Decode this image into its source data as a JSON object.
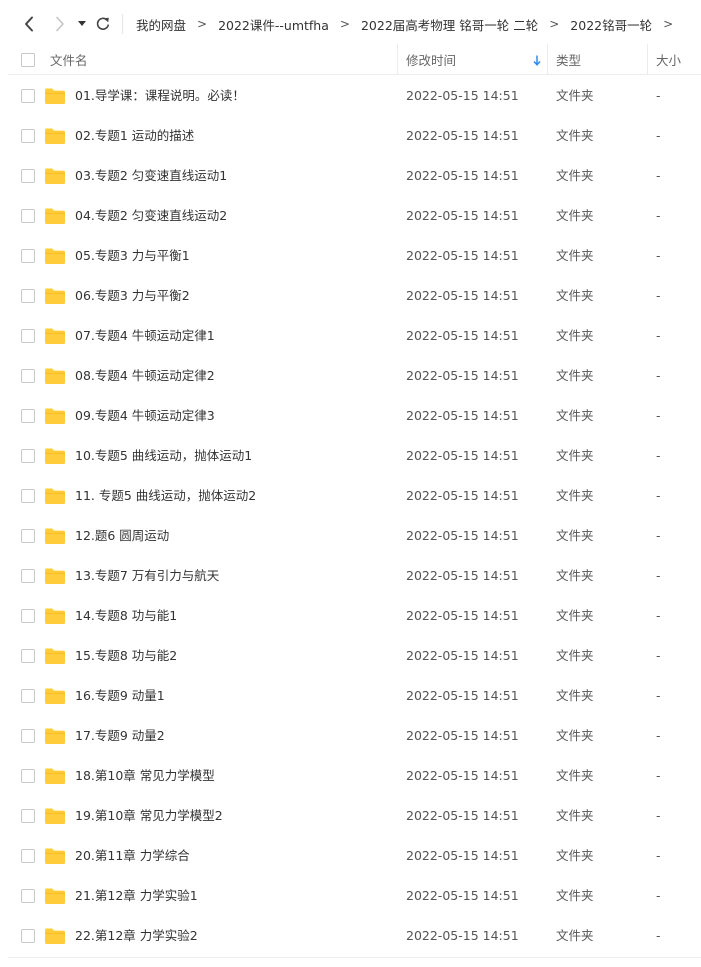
{
  "nav": {
    "back_icon": "chevron-left-icon",
    "forward_icon": "chevron-right-icon",
    "history_icon": "caret-down-icon",
    "refresh_icon": "refresh-icon"
  },
  "breadcrumb": [
    "我的网盘",
    "2022课件--umtfha",
    "2022届高考物理 铭哥一轮 二轮",
    "2022铭哥一轮"
  ],
  "breadcrumb_separator": ">",
  "columns": {
    "name": "文件名",
    "modified": "修改时间",
    "type": "类型",
    "size": "大小"
  },
  "sort": {
    "column": "modified",
    "direction": "down",
    "color": "#2b8cf0"
  },
  "folder_color": "#ffcd3c",
  "files": [
    {
      "name": "01.导学课：课程说明。必读！",
      "time": "2022-05-15 14:51",
      "type": "文件夹",
      "size": "-"
    },
    {
      "name": "02.专题1 运动的描述",
      "time": "2022-05-15 14:51",
      "type": "文件夹",
      "size": "-"
    },
    {
      "name": "03.专题2 匀变速直线运动1",
      "time": "2022-05-15 14:51",
      "type": "文件夹",
      "size": "-"
    },
    {
      "name": "04.专题2 匀变速直线运动2",
      "time": "2022-05-15 14:51",
      "type": "文件夹",
      "size": "-"
    },
    {
      "name": "05.专题3 力与平衡1",
      "time": "2022-05-15 14:51",
      "type": "文件夹",
      "size": "-"
    },
    {
      "name": "06.专题3 力与平衡2",
      "time": "2022-05-15 14:51",
      "type": "文件夹",
      "size": "-"
    },
    {
      "name": "07.专题4 牛顿运动定律1",
      "time": "2022-05-15 14:51",
      "type": "文件夹",
      "size": "-"
    },
    {
      "name": "08.专题4 牛顿运动定律2",
      "time": "2022-05-15 14:51",
      "type": "文件夹",
      "size": "-"
    },
    {
      "name": "09.专题4 牛顿运动定律3",
      "time": "2022-05-15 14:51",
      "type": "文件夹",
      "size": "-"
    },
    {
      "name": "10.专题5 曲线运动，抛体运动1",
      "time": "2022-05-15 14:51",
      "type": "文件夹",
      "size": "-"
    },
    {
      "name": "11. 专题5 曲线运动，抛体运动2",
      "time": "2022-05-15 14:51",
      "type": "文件夹",
      "size": "-"
    },
    {
      "name": "12.题6 圆周运动",
      "time": "2022-05-15 14:51",
      "type": "文件夹",
      "size": "-"
    },
    {
      "name": "13.专题7 万有引力与航天",
      "time": "2022-05-15 14:51",
      "type": "文件夹",
      "size": "-"
    },
    {
      "name": "14.专题8 功与能1",
      "time": "2022-05-15 14:51",
      "type": "文件夹",
      "size": "-"
    },
    {
      "name": "15.专题8 功与能2",
      "time": "2022-05-15 14:51",
      "type": "文件夹",
      "size": "-"
    },
    {
      "name": "16.专题9 动量1",
      "time": "2022-05-15 14:51",
      "type": "文件夹",
      "size": "-"
    },
    {
      "name": "17.专题9 动量2",
      "time": "2022-05-15 14:51",
      "type": "文件夹",
      "size": "-"
    },
    {
      "name": "18.第10章 常见力学模型",
      "time": "2022-05-15 14:51",
      "type": "文件夹",
      "size": "-"
    },
    {
      "name": "19.第10章 常见力学模型2",
      "time": "2022-05-15 14:51",
      "type": "文件夹",
      "size": "-"
    },
    {
      "name": "20.第11章 力学综合",
      "time": "2022-05-15 14:51",
      "type": "文件夹",
      "size": "-"
    },
    {
      "name": "21.第12章 力学实验1",
      "time": "2022-05-15 14:51",
      "type": "文件夹",
      "size": "-"
    },
    {
      "name": "22.第12章 力学实验2",
      "time": "2022-05-15 14:51",
      "type": "文件夹",
      "size": "-"
    }
  ]
}
